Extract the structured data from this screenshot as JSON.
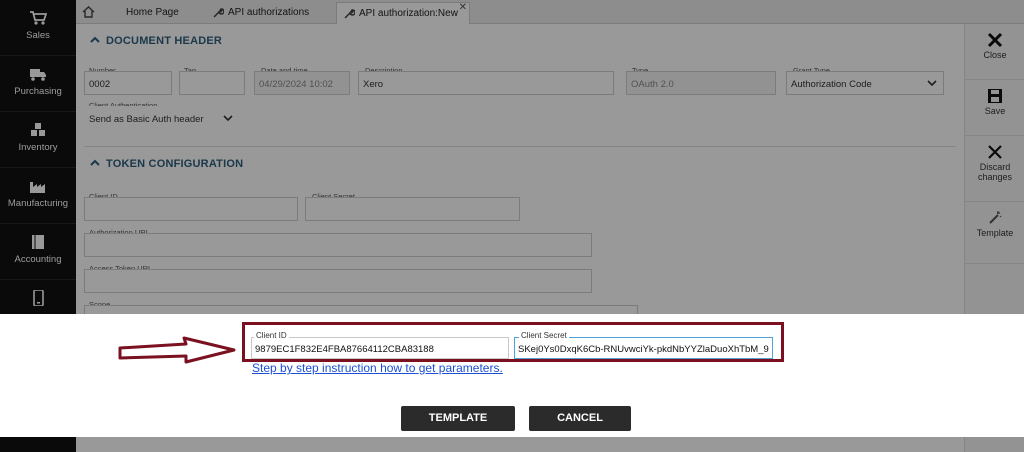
{
  "nav": {
    "items": [
      {
        "label": "Sales",
        "icon": "cart-icon"
      },
      {
        "label": "Purchasing",
        "icon": "truck-icon"
      },
      {
        "label": "Inventory",
        "icon": "boxes-icon"
      },
      {
        "label": "Manufacturing",
        "icon": "factory-icon"
      },
      {
        "label": "Accounting",
        "icon": "ledger-icon"
      },
      {
        "label": "",
        "icon": "mobile-icon"
      }
    ]
  },
  "tabs": [
    {
      "label": "Home Page"
    },
    {
      "label": "API authorizations"
    },
    {
      "label": "API authorization:New"
    }
  ],
  "doc_header": {
    "title": "DOCUMENT HEADER",
    "number": {
      "label": "Number",
      "value": "0002"
    },
    "tag": {
      "label": "Tag",
      "value": ""
    },
    "datetime": {
      "label": "Date and time",
      "value": "04/29/2024 10:02"
    },
    "description": {
      "label": "Description",
      "value": "Xero"
    },
    "type": {
      "label": "Type",
      "value": "OAuth 2.0"
    },
    "grant_type": {
      "label": "Grant Type",
      "value": "Authorization Code"
    },
    "client_auth": {
      "label": "Client Authentication",
      "value": "Send as Basic Auth header"
    }
  },
  "token_config": {
    "title": "TOKEN CONFIGURATION",
    "client_id": {
      "label": "Client ID",
      "value": ""
    },
    "client_secret": {
      "label": "Client Secret",
      "value": ""
    },
    "auth_url": {
      "label": "Authorization URL",
      "value": ""
    },
    "token_url": {
      "label": "Access Token URL",
      "value": ""
    },
    "scope": {
      "label": "Scope",
      "value": ""
    }
  },
  "toolbar": {
    "close": "Close",
    "save": "Save",
    "discard_1": "Discard",
    "discard_2": "changes",
    "template": "Template"
  },
  "modal": {
    "client_id": {
      "label": "Client ID",
      "value": "9879EC1F832E4FBA87664112CBA83188"
    },
    "client_secret": {
      "label": "Client Secret",
      "value": "SKej0Ys0DxqK6Cb-RNUvwciYk-pkdNbYYZlaDuoXhTbM_9"
    },
    "link": "Step by step instruction how to get parameters.",
    "template_btn": "TEMPLATE",
    "cancel_btn": "CANCEL"
  },
  "colors": {
    "highlight": "#7a1020",
    "link": "#1a4fd6",
    "section": "#2f5e7e"
  }
}
